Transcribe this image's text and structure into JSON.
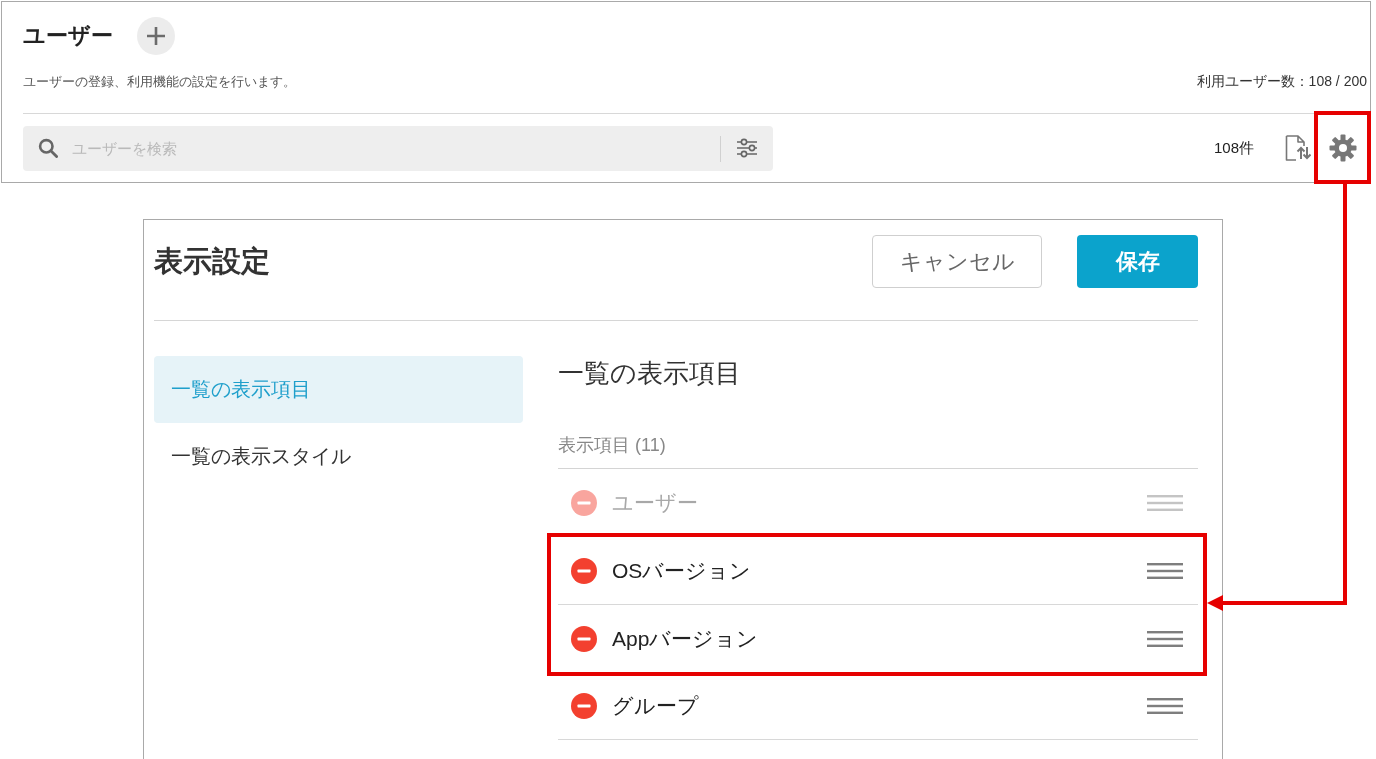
{
  "page": {
    "title": "ユーザー",
    "description": "ユーザーの登録、利用機能の設定を行います。",
    "user_count": "利用ユーザー数：108 / 200",
    "search": {
      "placeholder": "ユーザーを検索"
    },
    "result_count": "108件",
    "settings_button": {
      "highlighted": true
    }
  },
  "dialog": {
    "title": "表示設定",
    "buttons": [
      {
        "label": "キャンセル",
        "kind": "secondary"
      },
      {
        "label": "保存",
        "kind": "primary"
      }
    ],
    "sidebar": {
      "items": [
        {
          "label": "一覧の表示項目",
          "selected": true
        },
        {
          "label": "一覧の表示スタイル",
          "selected": false
        }
      ]
    },
    "section_title": "一覧の表示項目",
    "list_header": "表示項目 (11)",
    "items": [
      {
        "label": "ユーザー",
        "disabled": true,
        "highlighted": false
      },
      {
        "label": "OSバージョン",
        "disabled": false,
        "highlighted": true
      },
      {
        "label": "Appバージョン",
        "disabled": false,
        "highlighted": true
      },
      {
        "label": "グループ",
        "disabled": false,
        "highlighted": false
      }
    ]
  }
}
